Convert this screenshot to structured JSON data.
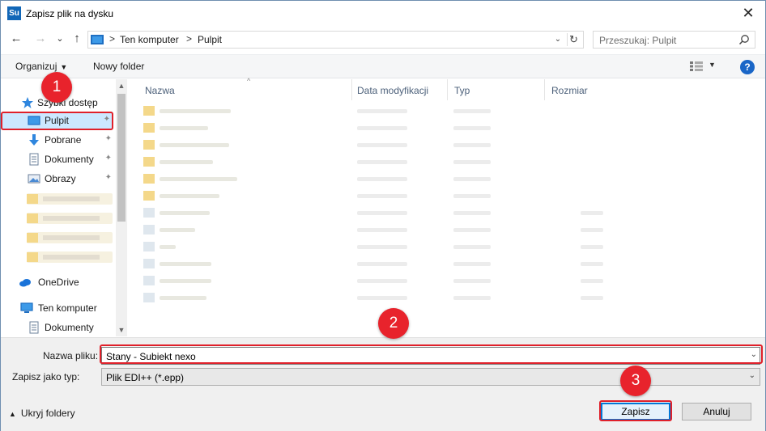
{
  "window": {
    "title": "Zapisz plik na dysku",
    "app_icon_text": "Su",
    "close_glyph": "✕"
  },
  "nav": {
    "back_glyph": "←",
    "forward_glyph": "→",
    "recent_glyph": "⌄",
    "up_glyph": "↑",
    "address": {
      "crumbs": [
        "Ten komputer",
        "Pulpit"
      ],
      "separator": ">"
    },
    "refresh_glyph": "↻",
    "dropdown_glyph": "⌄",
    "search_placeholder": "Przeszukaj: Pulpit"
  },
  "toolbar": {
    "organize_label": "Organizuj",
    "new_folder_label": "Nowy folder",
    "help_label": "?"
  },
  "sidebar": {
    "quick_access_label": "Szybki dostęp",
    "items": [
      {
        "label": "Pulpit",
        "icon": "desktop-icon",
        "pinned": true,
        "selected": true
      },
      {
        "label": "Pobrane",
        "icon": "download-icon",
        "pinned": true
      },
      {
        "label": "Dokumenty",
        "icon": "documents-icon",
        "pinned": true
      },
      {
        "label": "Obrazy",
        "icon": "pictures-icon",
        "pinned": true
      }
    ],
    "onedrive_label": "OneDrive",
    "this_pc_label": "Ten komputer",
    "this_pc_child_label": "Dokumenty",
    "pin_glyph": "📌"
  },
  "filelist": {
    "columns": [
      "Nazwa",
      "Data modyfikacji",
      "Typ",
      "Rozmiar"
    ],
    "sort_glyph": "^"
  },
  "form": {
    "filename_label": "Nazwa pliku:",
    "filename_value": "Stany - Subiekt nexo",
    "filetype_label": "Zapisz jako typ:",
    "filetype_value": "Plik EDI++ (*.epp)",
    "hide_folders_label": "Ukryj foldery",
    "save_label": "Zapisz",
    "cancel_label": "Anuluj"
  },
  "annotations": {
    "step1": "1",
    "step2": "2",
    "step3": "3",
    "color": "#e8232c"
  },
  "colors": {
    "accent": "#0078d7",
    "selection": "#cce8ff",
    "folder": "#f4d88a"
  }
}
